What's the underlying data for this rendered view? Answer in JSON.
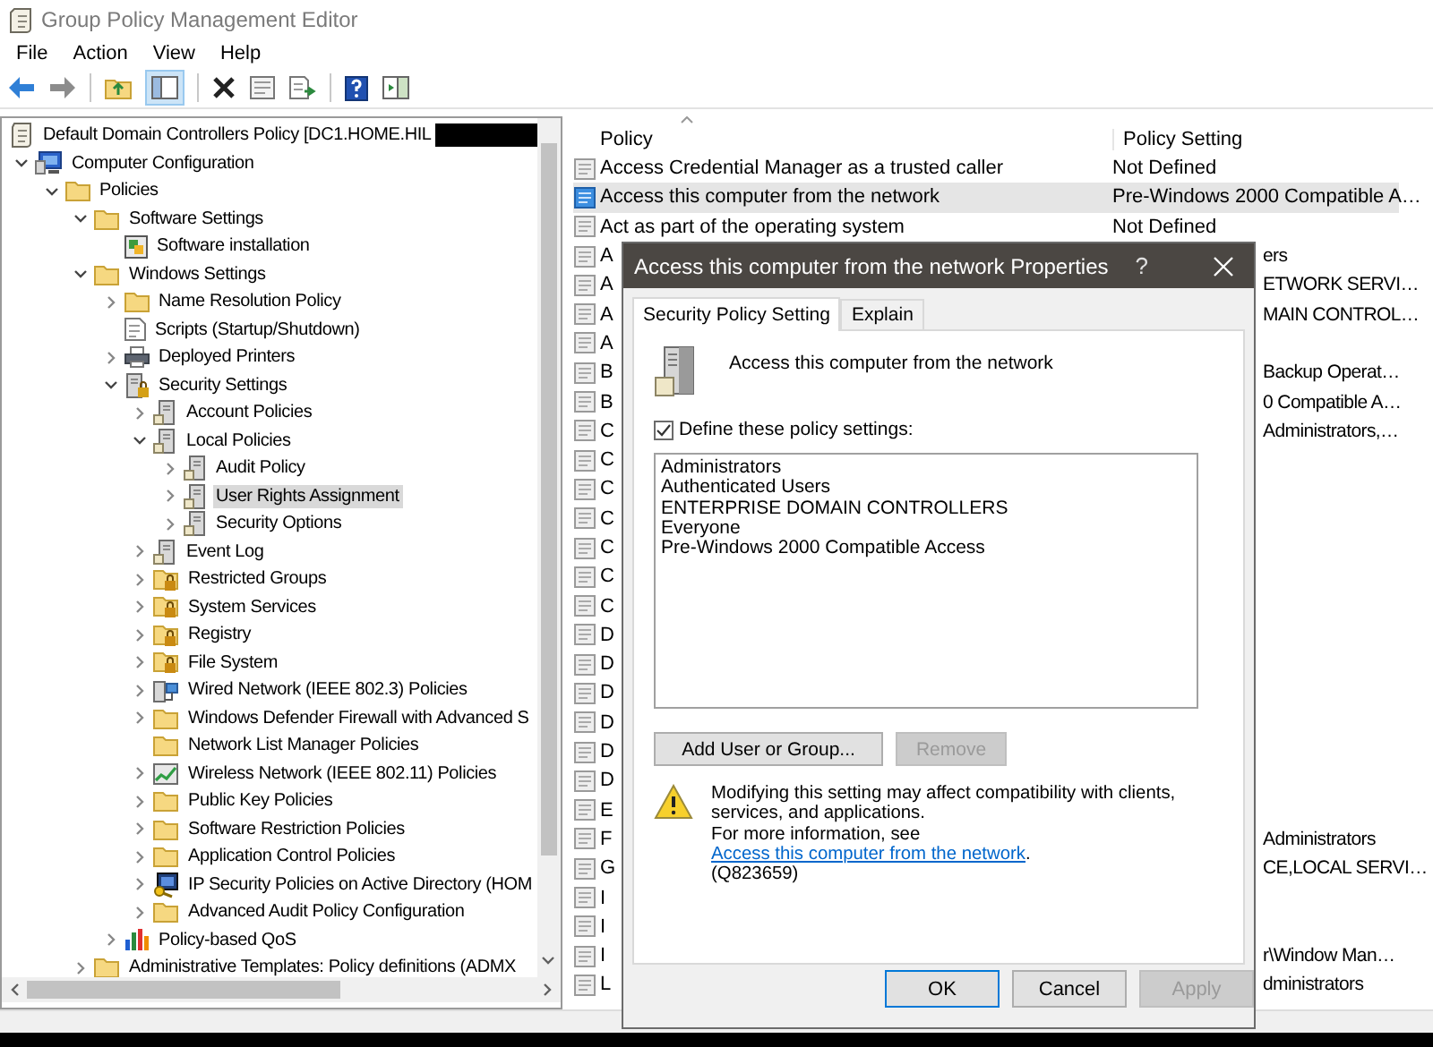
{
  "window": {
    "title": "Group Policy Management Editor"
  },
  "menu": [
    "File",
    "Action",
    "View",
    "Help"
  ],
  "toolbar": {
    "tree_toggle_pressed": true
  },
  "tree": {
    "label": "Default Domain Controllers Policy [DC1.HOME.HIL",
    "kind": "policy",
    "redacted": true,
    "selected": false,
    "children": [
      {
        "label": "Computer Configuration",
        "kind": "computer",
        "expanded": true,
        "selected": false,
        "children": [
          {
            "label": "Policies",
            "kind": "folder",
            "expanded": true,
            "selected": false,
            "children": [
              {
                "label": "Software Settings",
                "kind": "folder",
                "expanded": true,
                "selected": false,
                "children": [
                  {
                    "label": "Software installation",
                    "kind": "installer",
                    "selected": false
                  }
                ]
              },
              {
                "label": "Windows Settings",
                "kind": "folder",
                "expanded": true,
                "selected": false,
                "children": [
                  {
                    "label": "Name Resolution Policy",
                    "kind": "folder",
                    "expanded": false,
                    "selected": false
                  },
                  {
                    "label": "Scripts (Startup/Shutdown)",
                    "kind": "script",
                    "selected": false
                  },
                  {
                    "label": "Deployed Printers",
                    "kind": "printer",
                    "expanded": false,
                    "selected": false
                  },
                  {
                    "label": "Security Settings",
                    "kind": "security",
                    "expanded": true,
                    "selected": false,
                    "children": [
                      {
                        "label": "Account Policies",
                        "kind": "node",
                        "expanded": false,
                        "selected": false
                      },
                      {
                        "label": "Local Policies",
                        "kind": "node",
                        "expanded": true,
                        "selected": false,
                        "children": [
                          {
                            "label": "Audit Policy",
                            "kind": "node",
                            "expanded": false,
                            "selected": false
                          },
                          {
                            "label": "User Rights Assignment",
                            "kind": "node",
                            "expanded": false,
                            "selected": true
                          },
                          {
                            "label": "Security Options",
                            "kind": "node",
                            "expanded": false,
                            "selected": false
                          }
                        ]
                      },
                      {
                        "label": "Event Log",
                        "kind": "node",
                        "expanded": false,
                        "selected": false
                      },
                      {
                        "label": "Restricted Groups",
                        "kind": "locked-folder",
                        "expanded": false,
                        "selected": false
                      },
                      {
                        "label": "System Services",
                        "kind": "locked-folder",
                        "expanded": false,
                        "selected": false
                      },
                      {
                        "label": "Registry",
                        "kind": "locked-folder",
                        "expanded": false,
                        "selected": false
                      },
                      {
                        "label": "File System",
                        "kind": "locked-folder",
                        "expanded": false,
                        "selected": false
                      },
                      {
                        "label": "Wired Network (IEEE 802.3) Policies",
                        "kind": "wired",
                        "expanded": false,
                        "selected": false
                      },
                      {
                        "label": "Windows Defender Firewall with Advanced S",
                        "kind": "folder",
                        "expanded": false,
                        "selected": false
                      },
                      {
                        "label": "Network List Manager Policies",
                        "kind": "folder",
                        "selected": false
                      },
                      {
                        "label": "Wireless Network (IEEE 802.11) Policies",
                        "kind": "wireless",
                        "expanded": false,
                        "selected": false
                      },
                      {
                        "label": "Public Key Policies",
                        "kind": "folder",
                        "expanded": false,
                        "selected": false
                      },
                      {
                        "label": "Software Restriction Policies",
                        "kind": "folder",
                        "expanded": false,
                        "selected": false
                      },
                      {
                        "label": "Application Control Policies",
                        "kind": "folder",
                        "expanded": false,
                        "selected": false
                      },
                      {
                        "label": "IP Security Policies on Active Directory (HOM",
                        "kind": "ipsec",
                        "expanded": false,
                        "selected": false
                      },
                      {
                        "label": "Advanced Audit Policy Configuration",
                        "kind": "folder",
                        "expanded": false,
                        "selected": false
                      }
                    ]
                  },
                  {
                    "label": "Policy-based QoS",
                    "kind": "qos",
                    "expanded": false,
                    "selected": false
                  }
                ]
              },
              {
                "label": "Administrative Templates: Policy definitions (ADMX",
                "kind": "folder",
                "expanded": false,
                "selected": false
              }
            ]
          }
        ]
      }
    ]
  },
  "policies": {
    "columns": [
      "Policy",
      "Policy Setting"
    ],
    "rows": [
      {
        "kind": "full",
        "policy": "Access Credential Manager as a trusted caller",
        "setting": "Not Defined",
        "selected": false
      },
      {
        "kind": "full",
        "policy": "Access this computer from the network",
        "setting": "Pre-Windows 2000 Compatible A…",
        "selected": true
      },
      {
        "kind": "full",
        "policy": "Act as part of the operating system",
        "setting": "Not Defined",
        "selected": false
      },
      {
        "kind": "covered",
        "policy": "A",
        "setting": "ers",
        "selected": false
      },
      {
        "kind": "covered",
        "policy": "A",
        "setting": "ETWORK SERVI…",
        "selected": false
      },
      {
        "kind": "covered",
        "policy": "A",
        "setting": "MAIN CONTROL…",
        "selected": false
      },
      {
        "kind": "covered",
        "policy": "A",
        "selected": false
      },
      {
        "kind": "covered",
        "policy": "B",
        "setting": "Backup Operat…",
        "selected": false
      },
      {
        "kind": "covered",
        "policy": "B",
        "setting": "0 Compatible A…",
        "selected": false
      },
      {
        "kind": "covered",
        "policy": "C",
        "setting": "Administrators,…",
        "selected": false
      },
      {
        "kind": "covered",
        "policy": "C",
        "selected": false
      },
      {
        "kind": "covered",
        "policy": "C",
        "selected": false
      },
      {
        "kind": "covered",
        "policy": "C",
        "selected": false
      },
      {
        "kind": "covered",
        "policy": "C",
        "selected": false
      },
      {
        "kind": "covered",
        "policy": "C",
        "selected": false
      },
      {
        "kind": "covered",
        "policy": "C",
        "selected": false
      },
      {
        "kind": "covered",
        "policy": "D",
        "selected": false
      },
      {
        "kind": "covered",
        "policy": "D",
        "selected": false
      },
      {
        "kind": "covered",
        "policy": "D",
        "selected": false
      },
      {
        "kind": "covered",
        "policy": "D",
        "selected": false
      },
      {
        "kind": "covered",
        "policy": "D",
        "selected": false
      },
      {
        "kind": "covered",
        "policy": "D",
        "selected": false
      },
      {
        "kind": "covered",
        "policy": "E",
        "selected": false
      },
      {
        "kind": "covered",
        "policy": "F",
        "setting": "Administrators",
        "selected": false
      },
      {
        "kind": "covered",
        "policy": "G",
        "setting": "CE,LOCAL SERVI…",
        "selected": false
      },
      {
        "kind": "covered",
        "policy": "I",
        "selected": false
      },
      {
        "kind": "covered",
        "policy": "I",
        "selected": false
      },
      {
        "kind": "covered",
        "policy": "I",
        "setting": "r\\Window Man…",
        "selected": false
      },
      {
        "kind": "covered",
        "policy": "L",
        "setting": "dministrators",
        "selected": false
      }
    ]
  },
  "dialog": {
    "title": "Access this computer from the network Properties",
    "help_glyph": "?",
    "tabs": [
      {
        "label": "Security Policy Setting",
        "selected": true
      },
      {
        "label": "Explain",
        "selected": false
      }
    ],
    "policy_name": "Access this computer from the network",
    "define": {
      "label": "Define these policy settings:",
      "checked": true
    },
    "members": [
      "Administrators",
      "Authenticated Users",
      "ENTERPRISE DOMAIN CONTROLLERS",
      "Everyone",
      "Pre-Windows 2000 Compatible Access"
    ],
    "actions": [
      {
        "label": "Add User or Group...",
        "disabled": false
      },
      {
        "label": "Remove",
        "disabled": true
      }
    ],
    "warning": {
      "text": "Modifying this setting may affect compatibility with clients, services, and applications.",
      "more_prefix": "For more information, see ",
      "link": "Access this computer from the network",
      "more_suffix": ".",
      "ref": "(Q823659)"
    },
    "buttons": [
      {
        "label": "OK",
        "disabled": false,
        "focused": true
      },
      {
        "label": "Cancel",
        "disabled": false,
        "focused": false
      },
      {
        "label": "Apply",
        "disabled": true,
        "focused": false
      }
    ]
  }
}
